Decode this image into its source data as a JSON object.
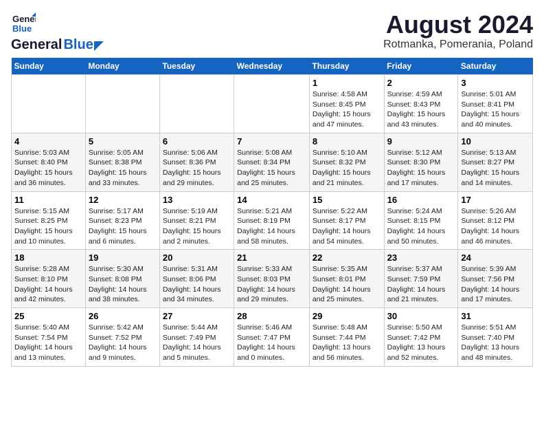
{
  "logo": {
    "line1": "General",
    "line2": "Blue"
  },
  "title": "August 2024",
  "subtitle": "Rotmanka, Pomerania, Poland",
  "weekdays": [
    "Sunday",
    "Monday",
    "Tuesday",
    "Wednesday",
    "Thursday",
    "Friday",
    "Saturday"
  ],
  "weeks": [
    [
      {
        "day": "",
        "info": ""
      },
      {
        "day": "",
        "info": ""
      },
      {
        "day": "",
        "info": ""
      },
      {
        "day": "",
        "info": ""
      },
      {
        "day": "1",
        "info": "Sunrise: 4:58 AM\nSunset: 8:45 PM\nDaylight: 15 hours\nand 47 minutes."
      },
      {
        "day": "2",
        "info": "Sunrise: 4:59 AM\nSunset: 8:43 PM\nDaylight: 15 hours\nand 43 minutes."
      },
      {
        "day": "3",
        "info": "Sunrise: 5:01 AM\nSunset: 8:41 PM\nDaylight: 15 hours\nand 40 minutes."
      }
    ],
    [
      {
        "day": "4",
        "info": "Sunrise: 5:03 AM\nSunset: 8:40 PM\nDaylight: 15 hours\nand 36 minutes."
      },
      {
        "day": "5",
        "info": "Sunrise: 5:05 AM\nSunset: 8:38 PM\nDaylight: 15 hours\nand 33 minutes."
      },
      {
        "day": "6",
        "info": "Sunrise: 5:06 AM\nSunset: 8:36 PM\nDaylight: 15 hours\nand 29 minutes."
      },
      {
        "day": "7",
        "info": "Sunrise: 5:08 AM\nSunset: 8:34 PM\nDaylight: 15 hours\nand 25 minutes."
      },
      {
        "day": "8",
        "info": "Sunrise: 5:10 AM\nSunset: 8:32 PM\nDaylight: 15 hours\nand 21 minutes."
      },
      {
        "day": "9",
        "info": "Sunrise: 5:12 AM\nSunset: 8:30 PM\nDaylight: 15 hours\nand 17 minutes."
      },
      {
        "day": "10",
        "info": "Sunrise: 5:13 AM\nSunset: 8:27 PM\nDaylight: 15 hours\nand 14 minutes."
      }
    ],
    [
      {
        "day": "11",
        "info": "Sunrise: 5:15 AM\nSunset: 8:25 PM\nDaylight: 15 hours\nand 10 minutes."
      },
      {
        "day": "12",
        "info": "Sunrise: 5:17 AM\nSunset: 8:23 PM\nDaylight: 15 hours\nand 6 minutes."
      },
      {
        "day": "13",
        "info": "Sunrise: 5:19 AM\nSunset: 8:21 PM\nDaylight: 15 hours\nand 2 minutes."
      },
      {
        "day": "14",
        "info": "Sunrise: 5:21 AM\nSunset: 8:19 PM\nDaylight: 14 hours\nand 58 minutes."
      },
      {
        "day": "15",
        "info": "Sunrise: 5:22 AM\nSunset: 8:17 PM\nDaylight: 14 hours\nand 54 minutes."
      },
      {
        "day": "16",
        "info": "Sunrise: 5:24 AM\nSunset: 8:15 PM\nDaylight: 14 hours\nand 50 minutes."
      },
      {
        "day": "17",
        "info": "Sunrise: 5:26 AM\nSunset: 8:12 PM\nDaylight: 14 hours\nand 46 minutes."
      }
    ],
    [
      {
        "day": "18",
        "info": "Sunrise: 5:28 AM\nSunset: 8:10 PM\nDaylight: 14 hours\nand 42 minutes."
      },
      {
        "day": "19",
        "info": "Sunrise: 5:30 AM\nSunset: 8:08 PM\nDaylight: 14 hours\nand 38 minutes."
      },
      {
        "day": "20",
        "info": "Sunrise: 5:31 AM\nSunset: 8:06 PM\nDaylight: 14 hours\nand 34 minutes."
      },
      {
        "day": "21",
        "info": "Sunrise: 5:33 AM\nSunset: 8:03 PM\nDaylight: 14 hours\nand 29 minutes."
      },
      {
        "day": "22",
        "info": "Sunrise: 5:35 AM\nSunset: 8:01 PM\nDaylight: 14 hours\nand 25 minutes."
      },
      {
        "day": "23",
        "info": "Sunrise: 5:37 AM\nSunset: 7:59 PM\nDaylight: 14 hours\nand 21 minutes."
      },
      {
        "day": "24",
        "info": "Sunrise: 5:39 AM\nSunset: 7:56 PM\nDaylight: 14 hours\nand 17 minutes."
      }
    ],
    [
      {
        "day": "25",
        "info": "Sunrise: 5:40 AM\nSunset: 7:54 PM\nDaylight: 14 hours\nand 13 minutes."
      },
      {
        "day": "26",
        "info": "Sunrise: 5:42 AM\nSunset: 7:52 PM\nDaylight: 14 hours\nand 9 minutes."
      },
      {
        "day": "27",
        "info": "Sunrise: 5:44 AM\nSunset: 7:49 PM\nDaylight: 14 hours\nand 5 minutes."
      },
      {
        "day": "28",
        "info": "Sunrise: 5:46 AM\nSunset: 7:47 PM\nDaylight: 14 hours\nand 0 minutes."
      },
      {
        "day": "29",
        "info": "Sunrise: 5:48 AM\nSunset: 7:44 PM\nDaylight: 13 hours\nand 56 minutes."
      },
      {
        "day": "30",
        "info": "Sunrise: 5:50 AM\nSunset: 7:42 PM\nDaylight: 13 hours\nand 52 minutes."
      },
      {
        "day": "31",
        "info": "Sunrise: 5:51 AM\nSunset: 7:40 PM\nDaylight: 13 hours\nand 48 minutes."
      }
    ]
  ]
}
